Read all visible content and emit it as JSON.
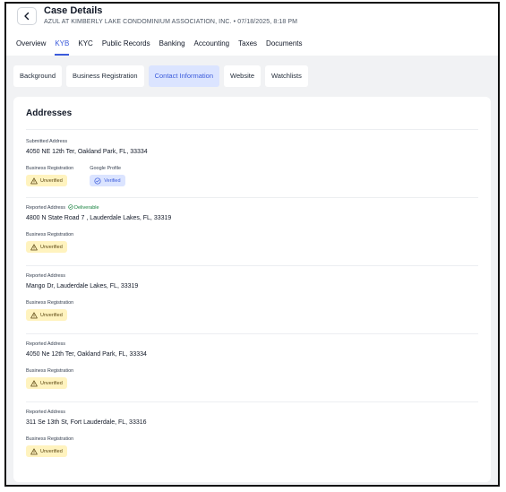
{
  "header": {
    "title": "Case Details",
    "subtitle": "AZUL AT KIMBERLY LAKE CONDOMINIUM ASSOCIATION, INC. • 07/18/2025, 8:18 PM"
  },
  "tabs": [
    "Overview",
    "KYB",
    "KYC",
    "Public Records",
    "Banking",
    "Accounting",
    "Taxes",
    "Documents"
  ],
  "active_tab": "KYB",
  "subtabs": [
    "Background",
    "Business Registration",
    "Contact Information",
    "Website",
    "Watchlists"
  ],
  "active_subtab": "Contact Information",
  "section_title": "Addresses",
  "addresses": [
    {
      "label": "Submitted Address",
      "deliverable": "",
      "address": "4050 NE 12th Ter, Oakland Park, FL, 33334",
      "verifications": [
        {
          "source": "Business Registration",
          "status": "Unverified"
        },
        {
          "source": "Google Profile",
          "status": "Verified"
        }
      ]
    },
    {
      "label": "Reported Address",
      "deliverable": "Deliverable",
      "address": "4800 N State Road 7 , Lauderdale Lakes, FL, 33319",
      "verifications": [
        {
          "source": "Business Registration",
          "status": "Unverified"
        }
      ]
    },
    {
      "label": "Reported Address",
      "deliverable": "",
      "address": "Mango Dr, Lauderdale Lakes, FL, 33319",
      "verifications": [
        {
          "source": "Business Registration",
          "status": "Unverified"
        }
      ]
    },
    {
      "label": "Reported Address",
      "deliverable": "",
      "address": "4050 Ne 12th Ter, Oakland Park, FL, 33334",
      "verifications": [
        {
          "source": "Business Registration",
          "status": "Unverified"
        }
      ]
    },
    {
      "label": "Reported Address",
      "deliverable": "",
      "address": "311 Se 13th St, Fort Lauderdale, FL, 33316",
      "verifications": [
        {
          "source": "Business Registration",
          "status": "Unverified"
        }
      ]
    }
  ],
  "colors": {
    "accent": "#3b5bdb",
    "unverified_bg": "#fff3bf",
    "verified_bg": "#dbe4ff",
    "deliverable": "#15803d"
  }
}
